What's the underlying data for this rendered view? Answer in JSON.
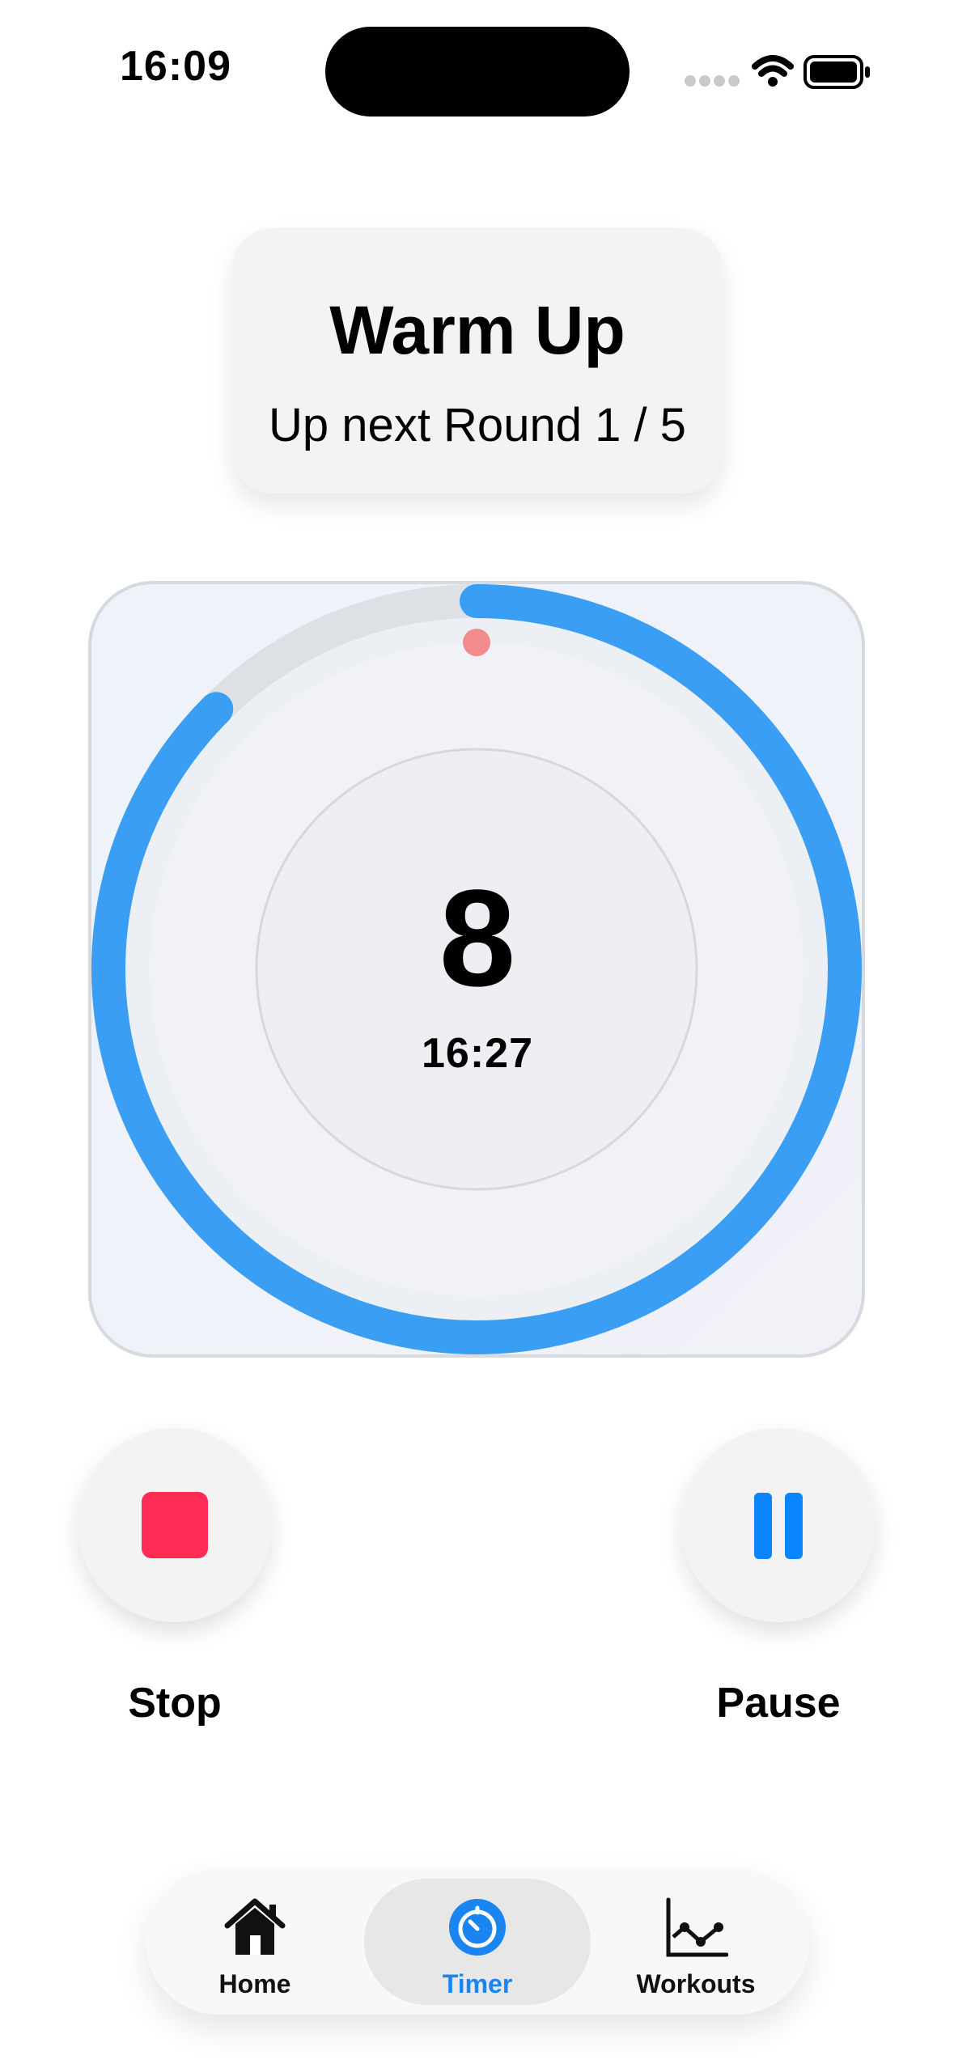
{
  "status_bar": {
    "time": "16:09"
  },
  "header_card": {
    "title": "Warm Up",
    "subtitle": "Up next Round 1 / 5"
  },
  "timer": {
    "count": "8",
    "clock": "16:27",
    "progress_fraction": 0.875,
    "ring_color": "#3a9ef5",
    "marker_color": "#f28b8b"
  },
  "controls": {
    "stop_label": "Stop",
    "pause_label": "Pause",
    "stop_color": "#ff2d55",
    "pause_color": "#0a84ff"
  },
  "tab_bar": {
    "active": "Timer",
    "tabs": [
      {
        "label": "Home",
        "icon": "house-icon"
      },
      {
        "label": "Timer",
        "icon": "timer-icon"
      },
      {
        "label": "Workouts",
        "icon": "chart-line-icon"
      }
    ]
  }
}
